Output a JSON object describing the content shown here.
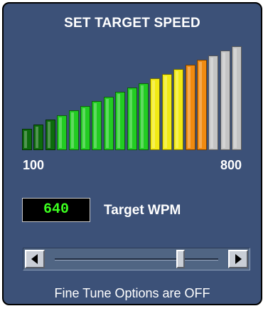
{
  "panel": {
    "title": "SET TARGET SPEED"
  },
  "meter": {
    "min_label": "100",
    "max_label": "800",
    "bar_count": 19,
    "segments": [
      {
        "color": "#0d6b0d",
        "count": 3
      },
      {
        "color": "#22cc22",
        "count": 8
      },
      {
        "color": "#f2ea14",
        "count": 3
      },
      {
        "color": "#f08a10",
        "count": 2
      },
      {
        "color": "#c4c4c4",
        "count": 3
      }
    ]
  },
  "target": {
    "value": "640",
    "label": "Target WPM"
  },
  "slider": {
    "min": 100,
    "max": 800,
    "value": 640
  },
  "status": {
    "fine_tune": "Fine Tune Options are OFF"
  },
  "colors": {
    "panel": "#3c5178",
    "display_text": "#3cff1f"
  }
}
